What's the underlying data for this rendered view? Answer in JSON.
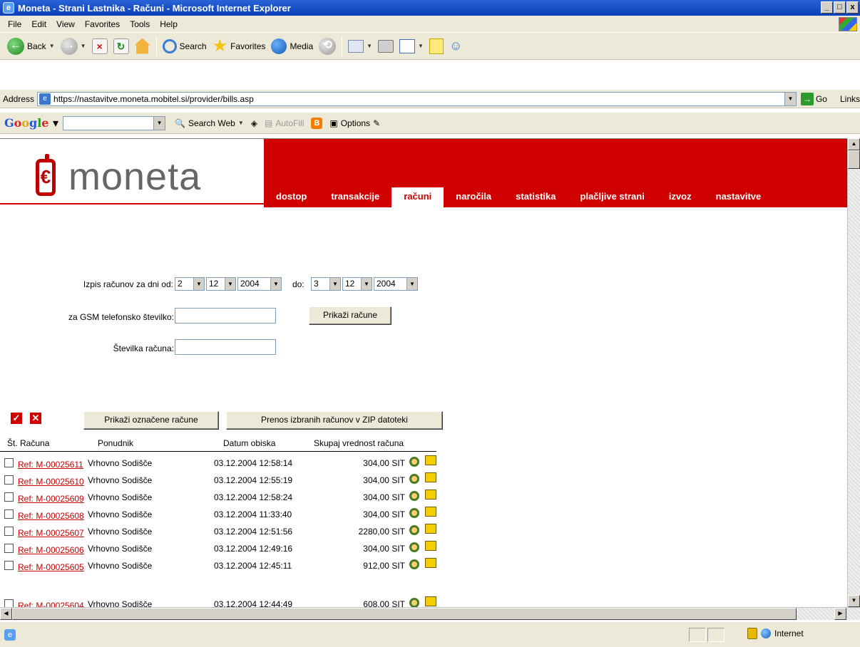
{
  "window": {
    "title": "Moneta - Strani Lastnika - Računi - Microsoft Internet Explorer"
  },
  "menu": [
    "File",
    "Edit",
    "View",
    "Favorites",
    "Tools",
    "Help"
  ],
  "toolbar": {
    "back": "Back",
    "search": "Search",
    "favorites": "Favorites",
    "media": "Media"
  },
  "address": {
    "label": "Address",
    "url": "https://nastavitve.moneta.mobitel.si/provider/bills.asp",
    "go": "Go",
    "links": "Links"
  },
  "google": {
    "search_web": "Search Web",
    "autofill": "AutoFill",
    "options": "Options"
  },
  "nav": [
    "dostop",
    "transakcije",
    "računi",
    "naročila",
    "statistika",
    "plačljive strani",
    "izvoz",
    "nastavitve"
  ],
  "nav_active": "računi",
  "logo_text": "moneta",
  "form": {
    "date_label": "Izpis računov za dni od:",
    "from": {
      "day": "2",
      "month": "12",
      "year": "2004"
    },
    "to_label": "do:",
    "to": {
      "day": "3",
      "month": "12",
      "year": "2004"
    },
    "gsm_label": "za GSM telefonsko številko:",
    "show_button": "Prikaži račune",
    "bill_label": "Številka računa:"
  },
  "actions": {
    "show_selected": "Prikaži označene račune",
    "zip": "Prenos izbranih računov v ZIP datoteki"
  },
  "table": {
    "headers": [
      "Št. Računa",
      "Ponudnik",
      "Datum obiska",
      "Skupaj vrednost računa"
    ],
    "rows": [
      {
        "ref": "Ref: M-00025611",
        "ponudnik": "Vrhovno Sodišče",
        "datum": "03.12.2004 12:58:14",
        "vrednost": "304,00 SIT"
      },
      {
        "ref": "Ref: M-00025610",
        "ponudnik": "Vrhovno Sodišče",
        "datum": "03.12.2004 12:55:19",
        "vrednost": "304,00 SIT"
      },
      {
        "ref": "Ref: M-00025609",
        "ponudnik": "Vrhovno Sodišče",
        "datum": "03.12.2004 12:58:24",
        "vrednost": "304,00 SIT"
      },
      {
        "ref": "Ref: M-00025608",
        "ponudnik": "Vrhovno Sodišče",
        "datum": "03.12.2004 11:33:40",
        "vrednost": "304,00 SIT"
      },
      {
        "ref": "Ref: M-00025607",
        "ponudnik": "Vrhovno Sodišče",
        "datum": "03.12.2004 12:51:56",
        "vrednost": "2280,00 SIT"
      },
      {
        "ref": "Ref: M-00025606",
        "ponudnik": "Vrhovno Sodišče",
        "datum": "03.12.2004 12:49:16",
        "vrednost": "304,00 SIT"
      },
      {
        "ref": "Ref: M-00025605",
        "ponudnik": "Vrhovno Sodišče",
        "datum": "03.12.2004 12:45:11",
        "vrednost": "912,00 SIT"
      },
      {
        "ref": "Ref: M-00025604",
        "ponudnik": "Vrhovno Sodišče",
        "datum": "03.12.2004 12:44:49",
        "vrednost": "608,00 SIT"
      }
    ]
  },
  "status": {
    "zone": "Internet"
  },
  "colors": {
    "brand_red": "#d00000",
    "link_red": "#c00000",
    "chrome": "#ece9d8"
  }
}
